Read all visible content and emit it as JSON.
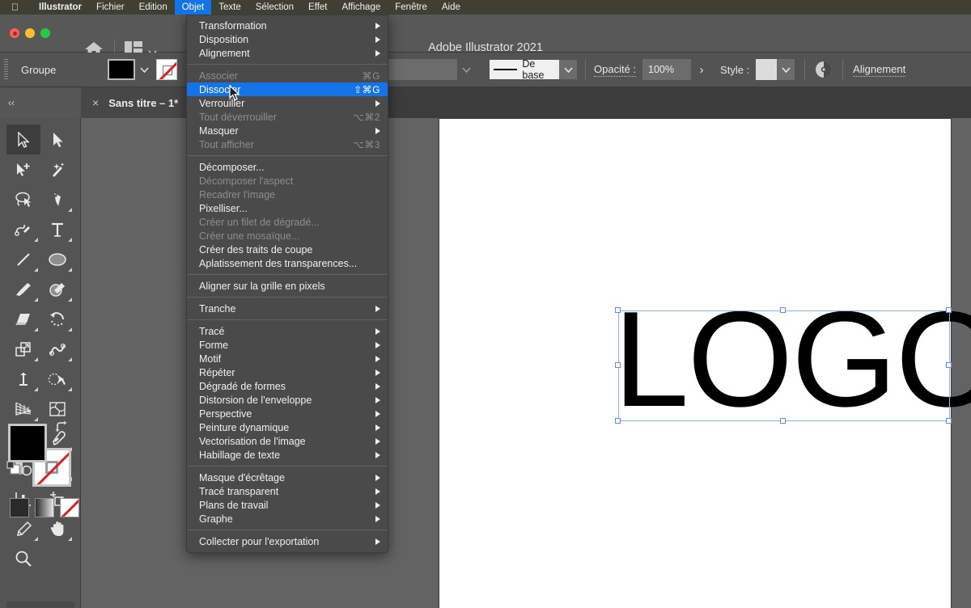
{
  "macbar": {
    "apple_icon": "apple-logo-icon",
    "items": [
      {
        "label": "Illustrator",
        "bold": true,
        "active": false
      },
      {
        "label": "Fichier",
        "bold": false,
        "active": false
      },
      {
        "label": "Edition",
        "bold": false,
        "active": false
      },
      {
        "label": "Objet",
        "bold": false,
        "active": true
      },
      {
        "label": "Texte",
        "bold": false,
        "active": false
      },
      {
        "label": "Sélection",
        "bold": false,
        "active": false
      },
      {
        "label": "Effet",
        "bold": false,
        "active": false
      },
      {
        "label": "Affichage",
        "bold": false,
        "active": false
      },
      {
        "label": "Fenêtre",
        "bold": false,
        "active": false
      },
      {
        "label": "Aide",
        "bold": false,
        "active": false
      }
    ]
  },
  "titlebar": {
    "window_title": "Adobe Illustrator 2021",
    "home_icon": "home-icon",
    "arrange_icon": "layout-arrange-icon",
    "chevron_icon": "chevron-down-icon"
  },
  "controlbar": {
    "selection_label": "Groupe",
    "fill_swatch_color": "#000000",
    "stroke_swatch": "none",
    "stroke_style_label": "De base",
    "opacity_label": "Opacité :",
    "opacity_value": "100%",
    "opacity_more": "›",
    "style_label": "Style :",
    "style_swatch_color": "#dcdcdc",
    "recolor_icon": "recolor-artwork-icon",
    "align_label": "Alignement"
  },
  "tabstrip": {
    "collapse_label": "‹‹",
    "tab_close_icon": "close-icon",
    "tab_title": "Sans titre – 1*"
  },
  "toolbar": {
    "tools": [
      {
        "name": "selection-tool",
        "selected": true,
        "corner": false
      },
      {
        "name": "direct-selection-tool",
        "selected": false,
        "corner": false
      },
      {
        "name": "magic-wand-add-tool",
        "selected": false,
        "corner": false
      },
      {
        "name": "magic-wand-tool",
        "selected": false,
        "corner": false
      },
      {
        "name": "lasso-tool",
        "selected": false,
        "corner": false
      },
      {
        "name": "pen-tool",
        "selected": false,
        "corner": true
      },
      {
        "name": "curvature-tool",
        "selected": false,
        "corner": true
      },
      {
        "name": "type-tool",
        "selected": false,
        "corner": true
      },
      {
        "name": "line-segment-tool",
        "selected": false,
        "corner": true
      },
      {
        "name": "ellipse-shape-tool",
        "selected": false,
        "corner": true
      },
      {
        "name": "paintbrush-tool",
        "selected": false,
        "corner": true
      },
      {
        "name": "shaper-pencil-tool",
        "selected": false,
        "corner": true
      },
      {
        "name": "eraser-tool",
        "selected": false,
        "corner": true
      },
      {
        "name": "rotate-tool",
        "selected": false,
        "corner": true
      },
      {
        "name": "scale-tool",
        "selected": false,
        "corner": true
      },
      {
        "name": "width-warp-tool",
        "selected": false,
        "corner": true
      },
      {
        "name": "free-transform-tool",
        "selected": false,
        "corner": true
      },
      {
        "name": "shape-builder-tool",
        "selected": false,
        "corner": true
      },
      {
        "name": "perspective-grid-tool",
        "selected": false,
        "corner": true
      },
      {
        "name": "mesh-tool",
        "selected": false,
        "corner": false
      },
      {
        "name": "gradient-tool",
        "selected": false,
        "corner": false
      },
      {
        "name": "eyedropper-tool",
        "selected": false,
        "corner": true
      },
      {
        "name": "blend-tool",
        "selected": false,
        "corner": false
      },
      {
        "name": "symbol-sprayer-tool",
        "selected": false,
        "corner": true
      },
      {
        "name": "column-graph-tool",
        "selected": false,
        "corner": true
      },
      {
        "name": "artboard-tool",
        "selected": false,
        "corner": false
      },
      {
        "name": "slice-tool",
        "selected": false,
        "corner": true
      },
      {
        "name": "hand-tool",
        "selected": false,
        "corner": true
      },
      {
        "name": "zoom-tool",
        "selected": false,
        "corner": false
      }
    ],
    "fill_color": "#000000",
    "stroke_color": "none",
    "swap-icon": "swap-fill-stroke-icon",
    "default-icon": "default-fill-stroke-icon",
    "modes": [
      {
        "name": "color-mode",
        "kind": "solid"
      },
      {
        "name": "gradient-mode",
        "kind": "gradient"
      },
      {
        "name": "none-mode",
        "kind": "none"
      }
    ]
  },
  "menu": {
    "title": "Objet",
    "groups": [
      {
        "items": [
          {
            "label": "Transformation",
            "shortcut": "",
            "submenu": true,
            "disabled": false,
            "highlighted": false
          },
          {
            "label": "Disposition",
            "shortcut": "",
            "submenu": true,
            "disabled": false,
            "highlighted": false
          },
          {
            "label": "Alignement",
            "shortcut": "",
            "submenu": true,
            "disabled": false,
            "highlighted": false
          }
        ]
      },
      {
        "items": [
          {
            "label": "Associer",
            "shortcut": "⌘G",
            "submenu": false,
            "disabled": true,
            "highlighted": false
          },
          {
            "label": "Dissocier",
            "shortcut": "⇧⌘G",
            "submenu": false,
            "disabled": false,
            "highlighted": true
          },
          {
            "label": "Verrouiller",
            "shortcut": "",
            "submenu": true,
            "disabled": false,
            "highlighted": false
          },
          {
            "label": "Tout déverrouiller",
            "shortcut": "⌥⌘2",
            "submenu": false,
            "disabled": true,
            "highlighted": false
          },
          {
            "label": "Masquer",
            "shortcut": "",
            "submenu": true,
            "disabled": false,
            "highlighted": false
          },
          {
            "label": "Tout afficher",
            "shortcut": "⌥⌘3",
            "submenu": false,
            "disabled": true,
            "highlighted": false
          }
        ]
      },
      {
        "items": [
          {
            "label": "Décomposer...",
            "shortcut": "",
            "submenu": false,
            "disabled": false,
            "highlighted": false
          },
          {
            "label": "Décomposer l'aspect",
            "shortcut": "",
            "submenu": false,
            "disabled": true,
            "highlighted": false
          },
          {
            "label": "Recadrer l'image",
            "shortcut": "",
            "submenu": false,
            "disabled": true,
            "highlighted": false
          },
          {
            "label": "Pixelliser...",
            "shortcut": "",
            "submenu": false,
            "disabled": false,
            "highlighted": false
          },
          {
            "label": "Créer un filet de dégradé...",
            "shortcut": "",
            "submenu": false,
            "disabled": true,
            "highlighted": false
          },
          {
            "label": "Créer une mosaïque...",
            "shortcut": "",
            "submenu": false,
            "disabled": true,
            "highlighted": false
          },
          {
            "label": "Créer des traits de coupe",
            "shortcut": "",
            "submenu": false,
            "disabled": false,
            "highlighted": false
          },
          {
            "label": "Aplatissement des transparences...",
            "shortcut": "",
            "submenu": false,
            "disabled": false,
            "highlighted": false
          }
        ]
      },
      {
        "items": [
          {
            "label": "Aligner sur la grille en pixels",
            "shortcut": "",
            "submenu": false,
            "disabled": false,
            "highlighted": false
          }
        ]
      },
      {
        "items": [
          {
            "label": "Tranche",
            "shortcut": "",
            "submenu": true,
            "disabled": false,
            "highlighted": false
          }
        ]
      },
      {
        "items": [
          {
            "label": "Tracé",
            "shortcut": "",
            "submenu": true,
            "disabled": false,
            "highlighted": false
          },
          {
            "label": "Forme",
            "shortcut": "",
            "submenu": true,
            "disabled": false,
            "highlighted": false
          },
          {
            "label": "Motif",
            "shortcut": "",
            "submenu": true,
            "disabled": false,
            "highlighted": false
          },
          {
            "label": "Répéter",
            "shortcut": "",
            "submenu": true,
            "disabled": false,
            "highlighted": false
          },
          {
            "label": "Dégradé de formes",
            "shortcut": "",
            "submenu": true,
            "disabled": false,
            "highlighted": false
          },
          {
            "label": "Distorsion de l'enveloppe",
            "shortcut": "",
            "submenu": true,
            "disabled": false,
            "highlighted": false
          },
          {
            "label": "Perspective",
            "shortcut": "",
            "submenu": true,
            "disabled": false,
            "highlighted": false
          },
          {
            "label": "Peinture dynamique",
            "shortcut": "",
            "submenu": true,
            "disabled": false,
            "highlighted": false
          },
          {
            "label": "Vectorisation de l'image",
            "shortcut": "",
            "submenu": true,
            "disabled": false,
            "highlighted": false
          },
          {
            "label": "Habillage de texte",
            "shortcut": "",
            "submenu": true,
            "disabled": false,
            "highlighted": false
          }
        ]
      },
      {
        "items": [
          {
            "label": "Masque d'écrêtage",
            "shortcut": "",
            "submenu": true,
            "disabled": false,
            "highlighted": false
          },
          {
            "label": "Tracé transparent",
            "shortcut": "",
            "submenu": true,
            "disabled": false,
            "highlighted": false
          },
          {
            "label": "Plans de travail",
            "shortcut": "",
            "submenu": true,
            "disabled": false,
            "highlighted": false
          },
          {
            "label": "Graphe",
            "shortcut": "",
            "submenu": true,
            "disabled": false,
            "highlighted": false
          }
        ]
      },
      {
        "items": [
          {
            "label": "Collecter pour l'exportation",
            "shortcut": "",
            "submenu": true,
            "disabled": false,
            "highlighted": false
          }
        ]
      }
    ]
  },
  "canvas": {
    "artwork_text": "LOGO",
    "artwork_color": "#000000",
    "selection_color": "#5b8dea"
  }
}
